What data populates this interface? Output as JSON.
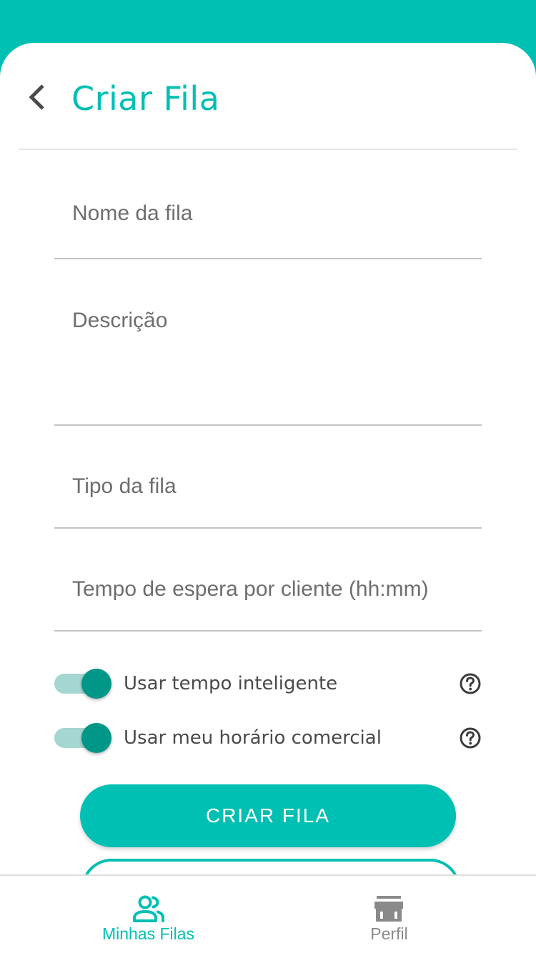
{
  "colors": {
    "accent": "#00BFB3",
    "switch_thumb": "#009688",
    "switch_track": "#A6D6D2",
    "nav_inactive": "#8A8A8A"
  },
  "header": {
    "back_icon": "chevron-left-icon",
    "title": "Criar Fila"
  },
  "form": {
    "fields": [
      {
        "label": "Nome da fila"
      },
      {
        "label": "Descrição"
      },
      {
        "label": "Tipo da fila"
      },
      {
        "label": "Tempo de espera por cliente (hh:mm)"
      }
    ],
    "toggles": [
      {
        "label": "Usar tempo inteligente",
        "on": true,
        "help_icon": "help-circle-icon"
      },
      {
        "label": "Usar meu horário comercial",
        "on": true,
        "help_icon": "help-circle-icon"
      }
    ],
    "submit_label": "CRIAR FILA"
  },
  "bottom_nav": {
    "items": [
      {
        "label": "Minhas Filas",
        "icon": "people-icon",
        "active": true
      },
      {
        "label": "Perfil",
        "icon": "store-icon",
        "active": false
      }
    ]
  }
}
